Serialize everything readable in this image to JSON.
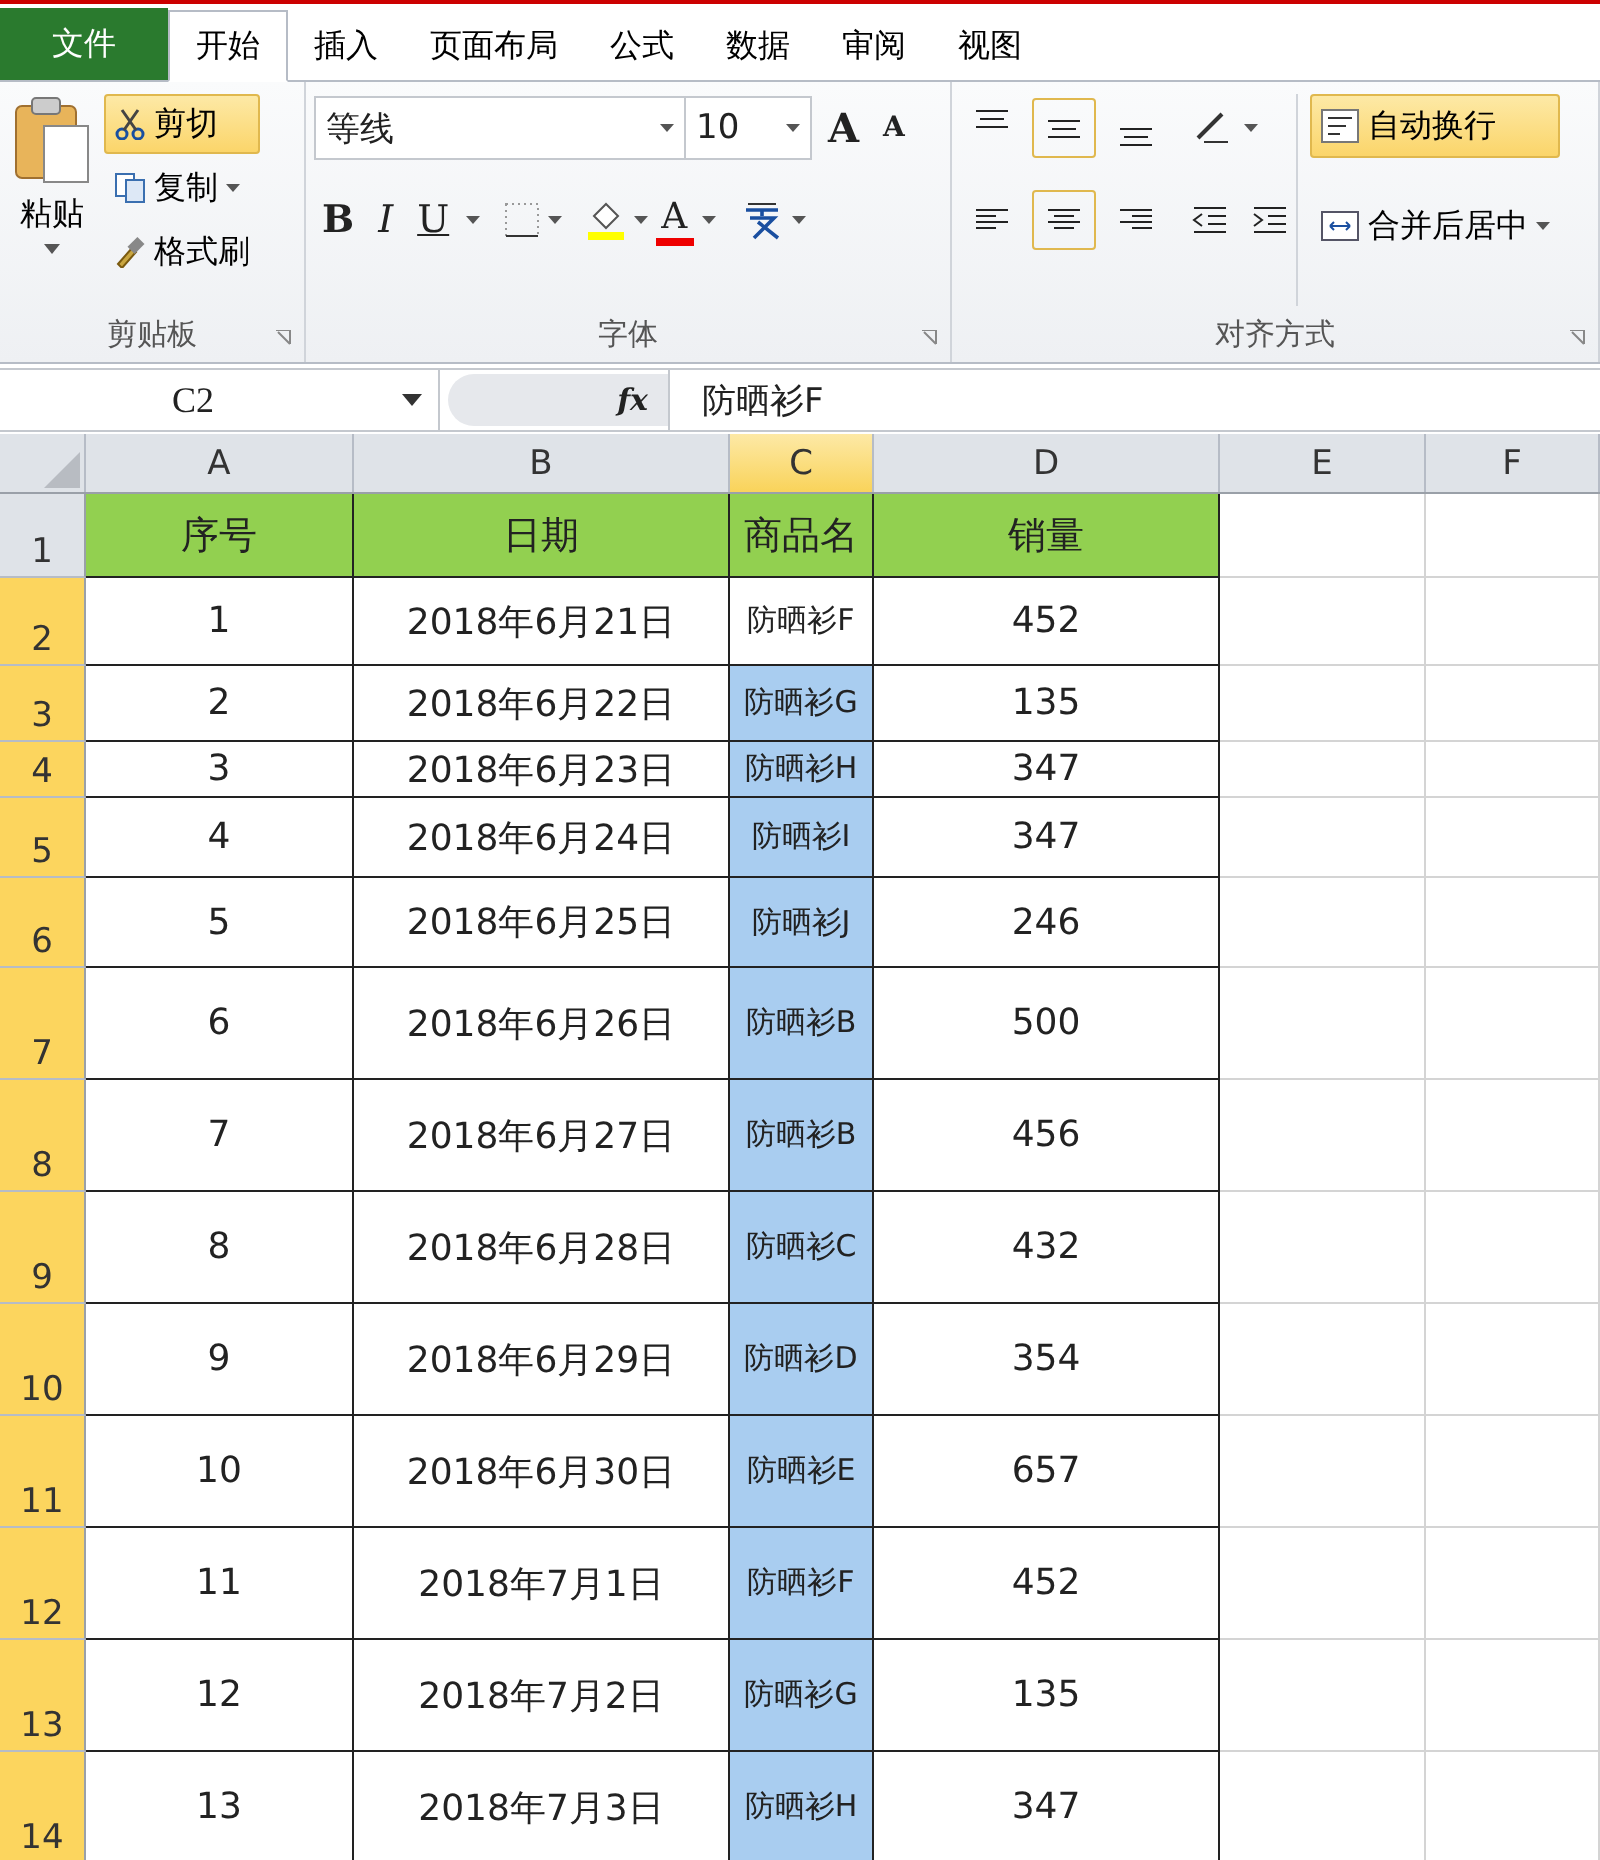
{
  "tabs": [
    {
      "label": "文件",
      "kind": "file",
      "selected": false
    },
    {
      "label": "开始",
      "kind": "tab",
      "selected": true
    },
    {
      "label": "插入",
      "kind": "tab",
      "selected": false
    },
    {
      "label": "页面布局",
      "kind": "tab",
      "selected": false
    },
    {
      "label": "公式",
      "kind": "tab",
      "selected": false
    },
    {
      "label": "数据",
      "kind": "tab",
      "selected": false
    },
    {
      "label": "审阅",
      "kind": "tab",
      "selected": false
    },
    {
      "label": "视图",
      "kind": "tab",
      "selected": false
    }
  ],
  "clipboard": {
    "paste": "粘贴",
    "cut": {
      "label": "剪切",
      "selected": true
    },
    "copy": "复制",
    "format_painter": "格式刷",
    "group": "剪贴板"
  },
  "font": {
    "name": "等线",
    "size": "10",
    "grow": "A",
    "shrink": "A",
    "bold": "B",
    "italic": "I",
    "underline": "U",
    "font_color": "A",
    "group": "字体"
  },
  "alignment": {
    "vertical": [
      {
        "kind": "top",
        "selected": false
      },
      {
        "kind": "middle",
        "selected": true
      },
      {
        "kind": "bottom",
        "selected": false
      }
    ],
    "horizontal": [
      {
        "kind": "left",
        "selected": false
      },
      {
        "kind": "center",
        "selected": true
      },
      {
        "kind": "right",
        "selected": false
      }
    ],
    "wrap": {
      "label": "自动换行",
      "selected": true
    },
    "merge": "合并后居中",
    "group": "对齐方式"
  },
  "formula_bar": {
    "name_box": "C2",
    "fx": "fx",
    "value": "防晒衫F"
  },
  "columns": [
    {
      "label": "A",
      "selected": false
    },
    {
      "label": "B",
      "selected": false
    },
    {
      "label": "C",
      "selected": true
    },
    {
      "label": "D",
      "selected": false
    },
    {
      "label": "E",
      "selected": false
    },
    {
      "label": "F",
      "selected": false
    }
  ],
  "rows": [
    {
      "num": "1",
      "kind": "header",
      "selected": false,
      "cells": [
        "序号",
        "日期",
        "商品名",
        "销量"
      ],
      "highlighted": false
    },
    {
      "num": "2",
      "kind": "data",
      "selected": true,
      "cells": [
        "1",
        "2018年6月21日",
        "防晒衫F",
        "452"
      ],
      "highlighted": false
    },
    {
      "num": "3",
      "kind": "data",
      "selected": true,
      "cells": [
        "2",
        "2018年6月22日",
        "防晒衫G",
        "135"
      ],
      "highlighted": true
    },
    {
      "num": "4",
      "kind": "data",
      "selected": true,
      "cells": [
        "3",
        "2018年6月23日",
        "防晒衫H",
        "347"
      ],
      "highlighted": true
    },
    {
      "num": "5",
      "kind": "data",
      "selected": true,
      "cells": [
        "4",
        "2018年6月24日",
        "防晒衫I",
        "347"
      ],
      "highlighted": true
    },
    {
      "num": "6",
      "kind": "data",
      "selected": true,
      "cells": [
        "5",
        "2018年6月25日",
        "防晒衫J",
        "246"
      ],
      "highlighted": true
    },
    {
      "num": "7",
      "kind": "data",
      "selected": true,
      "cells": [
        "6",
        "2018年6月26日",
        "防晒衫B",
        "500"
      ],
      "highlighted": true
    },
    {
      "num": "8",
      "kind": "data",
      "selected": true,
      "cells": [
        "7",
        "2018年6月27日",
        "防晒衫B",
        "456"
      ],
      "highlighted": true
    },
    {
      "num": "9",
      "kind": "data",
      "selected": true,
      "cells": [
        "8",
        "2018年6月28日",
        "防晒衫C",
        "432"
      ],
      "highlighted": true
    },
    {
      "num": "10",
      "kind": "data",
      "selected": true,
      "cells": [
        "9",
        "2018年6月29日",
        "防晒衫D",
        "354"
      ],
      "highlighted": true
    },
    {
      "num": "11",
      "kind": "data",
      "selected": true,
      "cells": [
        "10",
        "2018年6月30日",
        "防晒衫E",
        "657"
      ],
      "highlighted": true
    },
    {
      "num": "12",
      "kind": "data",
      "selected": true,
      "cells": [
        "11",
        "2018年7月1日",
        "防晒衫F",
        "452"
      ],
      "highlighted": true
    },
    {
      "num": "13",
      "kind": "data",
      "selected": true,
      "cells": [
        "12",
        "2018年7月2日",
        "防晒衫G",
        "135"
      ],
      "highlighted": true
    },
    {
      "num": "14",
      "kind": "data",
      "selected": true,
      "cells": [
        "13",
        "2018年7月3日",
        "防晒衫H",
        "347"
      ],
      "highlighted": true
    }
  ]
}
